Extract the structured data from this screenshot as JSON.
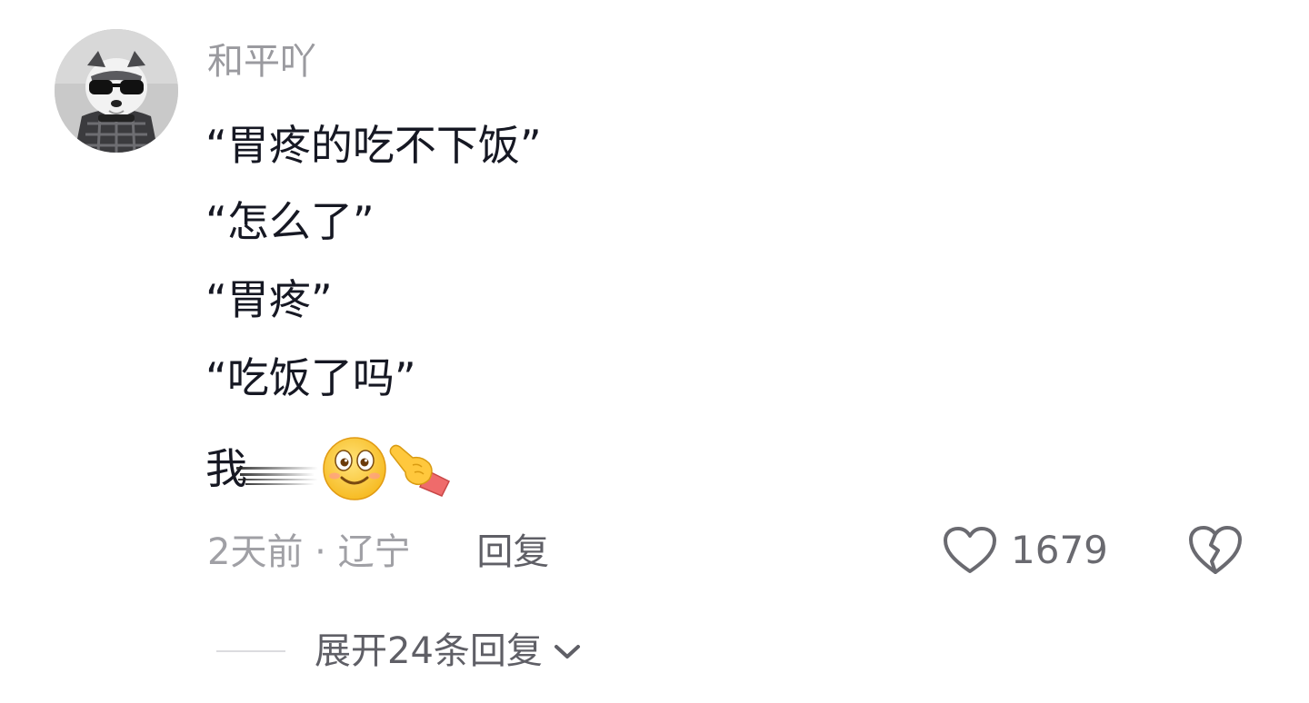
{
  "comment": {
    "username": "和平吖",
    "lines": [
      "“胃疼的吃不下饭”",
      "“怎么了”",
      "“胃疼”",
      "“吃饭了吗”"
    ],
    "last_line_text": "我",
    "emojis": [
      "smiling-face-emoji",
      "pointing-hand-emoji"
    ],
    "time_location": "2天前 · 辽宁",
    "reply_label": "回复",
    "like_count": "1679",
    "expand_label": "展开24条回复"
  },
  "icons": {
    "like": "heart-outline-icon",
    "dislike": "broken-heart-icon",
    "expand": "chevron-down-icon"
  },
  "colors": {
    "text_primary": "#161823",
    "text_secondary": "#9a9a9f",
    "action_text": "#5f5f66"
  }
}
